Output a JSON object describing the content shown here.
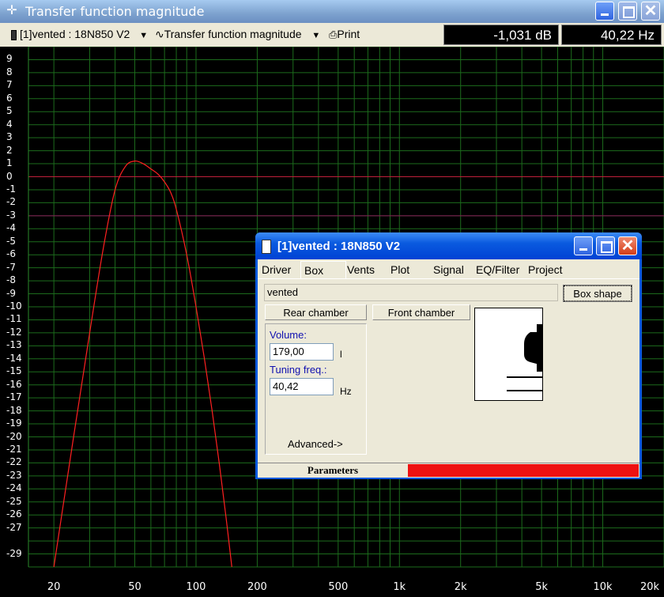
{
  "window": {
    "title": "Transfer function magnitude"
  },
  "toolbar": {
    "project_select": "[1]vented : 18N850 V2",
    "plot_select": "Transfer function magnitude",
    "print_label": "Print",
    "readout_db": "-1,031 dB",
    "readout_hz": "40,22 Hz"
  },
  "chart_data": {
    "type": "line",
    "xscale": "log",
    "xlim": [
      15,
      20000
    ],
    "ylim": [
      -30,
      10
    ],
    "y_ticks": [
      "9",
      "8",
      "7",
      "6",
      "5",
      "4",
      "3",
      "2",
      "1",
      "0",
      "-1",
      "-2",
      "-3",
      "-4",
      "-5",
      "-6",
      "-7",
      "-8",
      "-9",
      "-10",
      "-11",
      "-12",
      "-13",
      "-14",
      "-15",
      "-16",
      "-17",
      "-18",
      "-19",
      "-20",
      "-21",
      "-22",
      "-23",
      "-24",
      "-25",
      "-26",
      "-27",
      "-29"
    ],
    "x_ticks": [
      "20",
      "50",
      "100",
      "200",
      "500",
      "1k",
      "2k",
      "5k",
      "10k",
      "20k"
    ],
    "grid": true,
    "reference_lines_db": [
      0,
      -3
    ],
    "series": [
      {
        "color": "#ff2020",
        "x": [
          20,
          25,
          30,
          35,
          40,
          45,
          50,
          55,
          60,
          65,
          70,
          75,
          80,
          90,
          100,
          110,
          120,
          130,
          140,
          150
        ],
        "y": [
          -30,
          -20,
          -12,
          -5.5,
          -1,
          0.8,
          1.2,
          1.0,
          0.6,
          0.2,
          -0.4,
          -1.2,
          -2.5,
          -6,
          -10,
          -14,
          -18,
          -22,
          -26,
          -30
        ]
      }
    ]
  },
  "dialog": {
    "title": "[1]vented :  18N850 V2",
    "tabs": [
      "Driver",
      "Box",
      "Vents",
      "Plot",
      "Signal",
      "EQ/Filter",
      "Project"
    ],
    "box_type": "vented",
    "box_shape_label": "Box shape",
    "rear_chamber_label": "Rear chamber",
    "front_chamber_label": "Front chamber",
    "volume_label": "Volume:",
    "volume_value": "179,00",
    "volume_unit": "l",
    "tuning_label": "Tuning freq.:",
    "tuning_value": "40,42",
    "tuning_unit": "Hz",
    "advanced_label": "Advanced->",
    "status_label": "Parameters",
    "status_color": "#ee1111"
  }
}
